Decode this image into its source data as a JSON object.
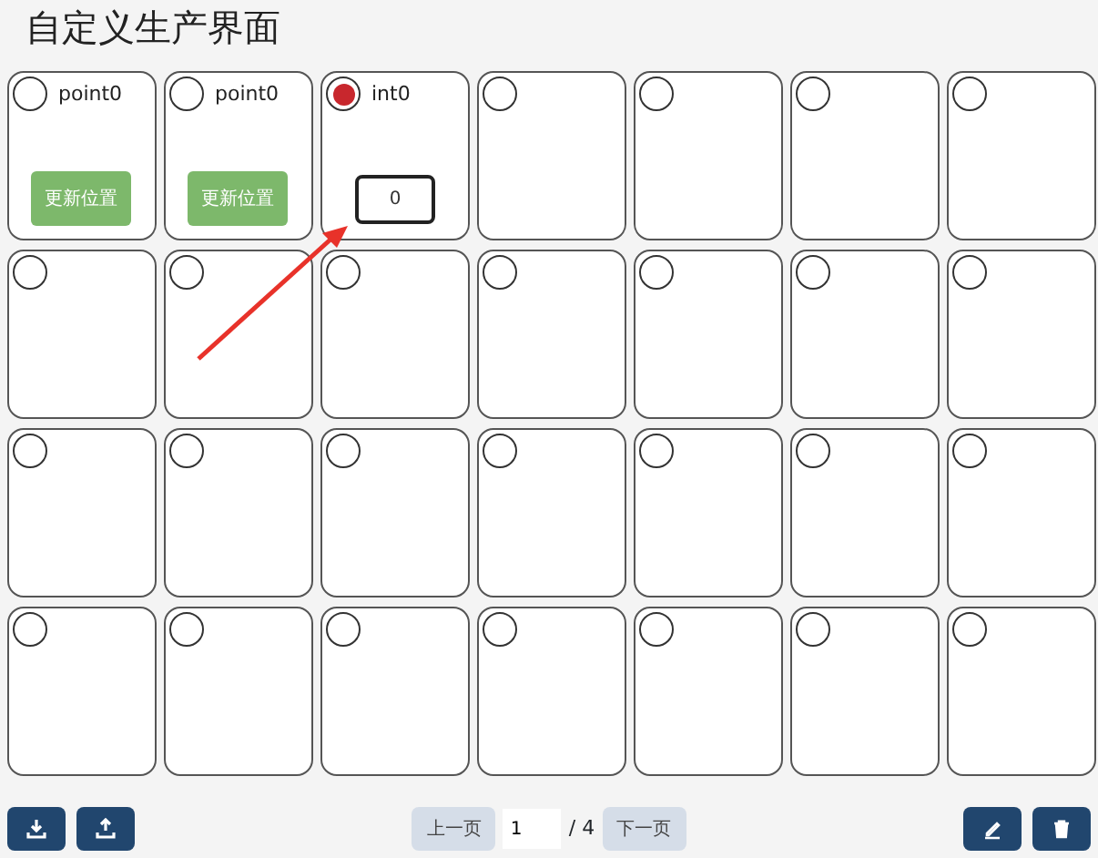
{
  "title": "自定义生产界面",
  "cells": [
    {
      "kind": "point",
      "label": "point0",
      "selected": false,
      "button": "更新位置"
    },
    {
      "kind": "point",
      "label": "point0",
      "selected": false,
      "button": "更新位置"
    },
    {
      "kind": "int",
      "label": "int0",
      "selected": true,
      "value": "0"
    },
    {
      "kind": "empty",
      "selected": false
    },
    {
      "kind": "empty",
      "selected": false
    },
    {
      "kind": "empty",
      "selected": false
    },
    {
      "kind": "empty",
      "selected": false
    },
    {
      "kind": "empty",
      "selected": false
    },
    {
      "kind": "empty",
      "selected": false
    },
    {
      "kind": "empty",
      "selected": false
    },
    {
      "kind": "empty",
      "selected": false
    },
    {
      "kind": "empty",
      "selected": false
    },
    {
      "kind": "empty",
      "selected": false
    },
    {
      "kind": "empty",
      "selected": false
    },
    {
      "kind": "empty",
      "selected": false
    },
    {
      "kind": "empty",
      "selected": false
    },
    {
      "kind": "empty",
      "selected": false
    },
    {
      "kind": "empty",
      "selected": false
    },
    {
      "kind": "empty",
      "selected": false
    },
    {
      "kind": "empty",
      "selected": false
    },
    {
      "kind": "empty",
      "selected": false
    },
    {
      "kind": "empty",
      "selected": false
    },
    {
      "kind": "empty",
      "selected": false
    },
    {
      "kind": "empty",
      "selected": false
    },
    {
      "kind": "empty",
      "selected": false
    },
    {
      "kind": "empty",
      "selected": false
    },
    {
      "kind": "empty",
      "selected": false
    },
    {
      "kind": "empty",
      "selected": false
    }
  ],
  "pagination": {
    "prev": "上一页",
    "page": "1",
    "total": "/ 4",
    "next": "下一页"
  }
}
